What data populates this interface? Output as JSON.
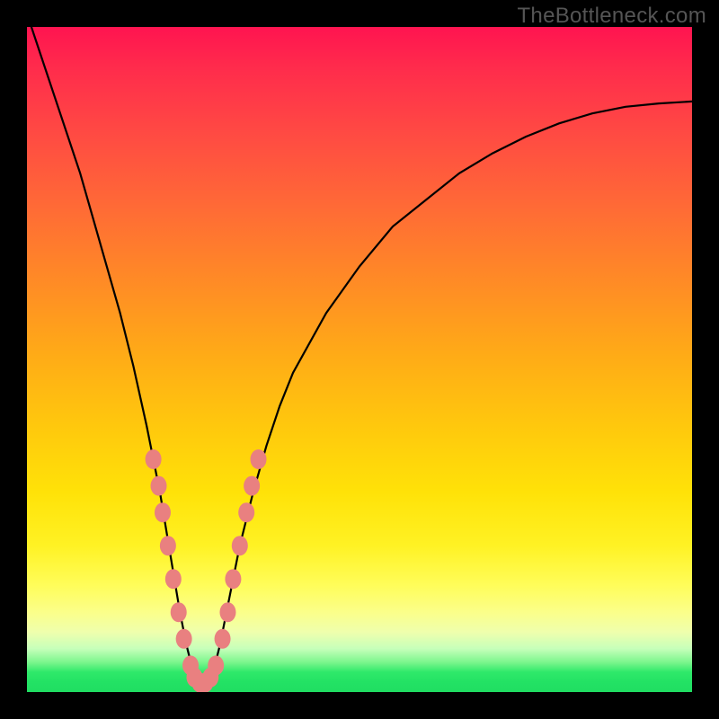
{
  "watermark": "TheBottleneck.com",
  "chart_data": {
    "type": "line",
    "title": "",
    "xlabel": "",
    "ylabel": "",
    "xlim": [
      0,
      100
    ],
    "ylim": [
      0,
      100
    ],
    "grid": false,
    "series": [
      {
        "name": "bottleneck-curve",
        "x": [
          0,
          2,
          4,
          6,
          8,
          10,
          12,
          14,
          16,
          18,
          20,
          22,
          23,
          24,
          25,
          26,
          27,
          28,
          29,
          30,
          32,
          34,
          36,
          38,
          40,
          45,
          50,
          55,
          60,
          65,
          70,
          75,
          80,
          85,
          90,
          95,
          100
        ],
        "values": [
          102,
          96,
          90,
          84,
          78,
          71,
          64,
          57,
          49,
          40,
          30,
          18,
          12,
          7,
          3,
          1,
          1,
          3,
          7,
          12,
          22,
          30,
          37,
          43,
          48,
          57,
          64,
          70,
          74,
          78,
          81,
          83.5,
          85.5,
          87,
          88,
          88.5,
          88.8
        ]
      }
    ],
    "markers": {
      "name": "highlight-dots",
      "color": "#e98080",
      "points": [
        {
          "x": 19.0,
          "y": 35
        },
        {
          "x": 19.8,
          "y": 31
        },
        {
          "x": 20.4,
          "y": 27
        },
        {
          "x": 21.2,
          "y": 22
        },
        {
          "x": 22.0,
          "y": 17
        },
        {
          "x": 22.8,
          "y": 12
        },
        {
          "x": 23.6,
          "y": 8
        },
        {
          "x": 24.6,
          "y": 4
        },
        {
          "x": 25.2,
          "y": 2.2
        },
        {
          "x": 26.0,
          "y": 1.4
        },
        {
          "x": 26.8,
          "y": 1.4
        },
        {
          "x": 27.6,
          "y": 2.2
        },
        {
          "x": 28.4,
          "y": 4
        },
        {
          "x": 29.4,
          "y": 8
        },
        {
          "x": 30.2,
          "y": 12
        },
        {
          "x": 31.0,
          "y": 17
        },
        {
          "x": 32.0,
          "y": 22
        },
        {
          "x": 33.0,
          "y": 27
        },
        {
          "x": 33.8,
          "y": 31
        },
        {
          "x": 34.8,
          "y": 35
        }
      ]
    },
    "background_gradient": {
      "top": "#ff1450",
      "mid": "#ffe208",
      "bottom": "#20de62"
    }
  }
}
